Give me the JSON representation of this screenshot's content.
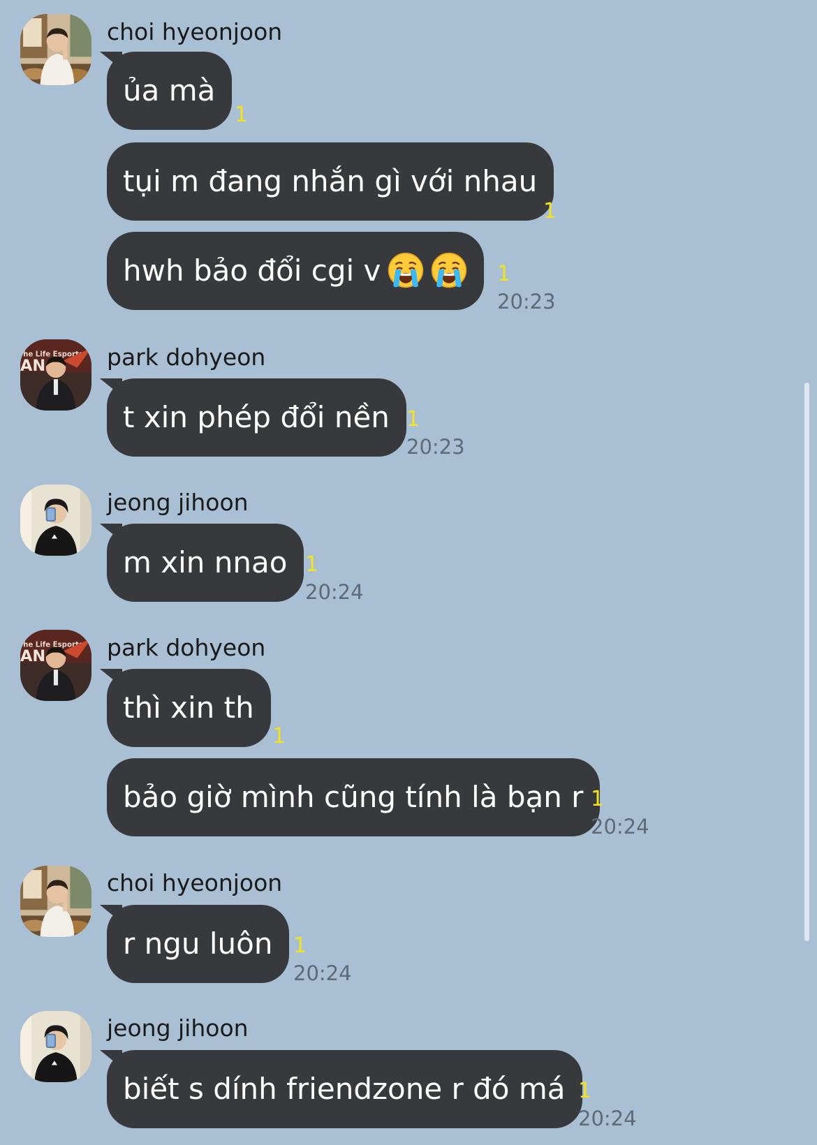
{
  "messages": [
    {
      "sender": "choi hyeonjoon",
      "text": "ủa mà",
      "unread": "1"
    },
    {
      "text": "tụi m đang nhắn gì với nhau",
      "unread": "1"
    },
    {
      "text": "hwh bảo đổi cgi v",
      "emoji": [
        "crying-face",
        "crying-face"
      ],
      "unread": "1",
      "time": "20:23"
    },
    {
      "sender": "park dohyeon",
      "text": "t xin phép đổi nền",
      "unread": "1",
      "time": "20:23"
    },
    {
      "sender": "jeong jihoon",
      "text": "m xin nnao",
      "unread": "1",
      "time": "20:24"
    },
    {
      "sender": "park dohyeon",
      "text": "thì xin th",
      "unread": "1"
    },
    {
      "text": "bảo giờ mình cũng tính là bạn r",
      "unread": "1",
      "time": "20:24"
    },
    {
      "sender": "choi hyeonjoon",
      "text": "r ngu luôn",
      "unread": "1",
      "time": "20:24"
    },
    {
      "sender": "jeong jihoon",
      "text": "biết s dính friendzone r đó má",
      "unread": "1",
      "time": "20:24"
    }
  ],
  "colors": {
    "background": "#a9bfd3",
    "bubble": "#38393d",
    "bubble_text": "#ffffff",
    "unread_count": "#f3e321",
    "timestamp": "#5d6a78"
  }
}
